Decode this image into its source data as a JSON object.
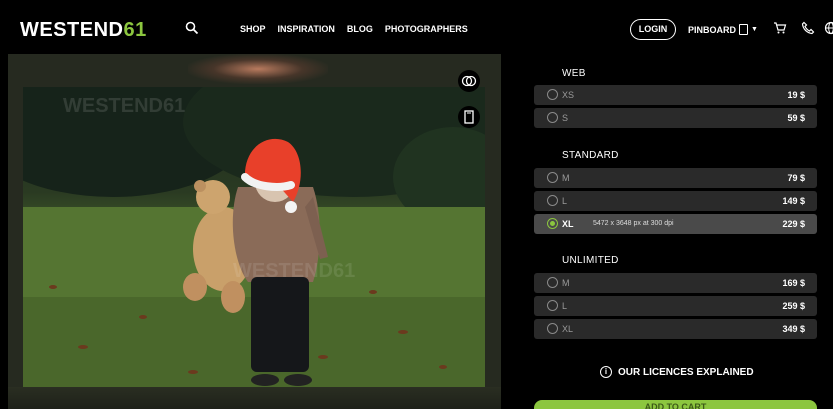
{
  "header": {
    "logo_main": "WESTEND",
    "logo_accent": "61",
    "nav": [
      "SHOP",
      "INSPIRATION",
      "BLOG",
      "PHOTOGRAPHERS"
    ],
    "login_label": "LOGIN",
    "pinboard_label": "PINBOARD",
    "icons": [
      "search-icon",
      "pinboard-icon",
      "cart-icon",
      "phone-icon",
      "globe-icon"
    ]
  },
  "viewer": {
    "photo_subject": "child in red Santa hat holding teddy bear on grass",
    "watermark": "WESTEND61",
    "tools": [
      "compare-icon",
      "pinboard-add-icon"
    ]
  },
  "licences": {
    "web": {
      "title": "WEB",
      "options": [
        {
          "size": "XS",
          "price": "19 $"
        },
        {
          "size": "S",
          "price": "59 $"
        }
      ]
    },
    "standard": {
      "title": "STANDARD",
      "options": [
        {
          "size": "M",
          "price": "79 $"
        },
        {
          "size": "L",
          "price": "149 $"
        },
        {
          "size": "XL",
          "price": "229 $",
          "spec": "5472 x 3648 px at 300 dpi",
          "selected": true
        }
      ]
    },
    "unlimited": {
      "title": "UNLIMITED",
      "options": [
        {
          "size": "M",
          "price": "169 $"
        },
        {
          "size": "L",
          "price": "259 $"
        },
        {
          "size": "XL",
          "price": "349 $"
        }
      ]
    },
    "explain_label": "OUR LICENCES EXPLAINED",
    "cart_label": "ADD TO CART"
  },
  "colors": {
    "accent": "#8cc63f",
    "background": "#000000",
    "option_bg": "#2a2a2a",
    "option_selected_bg": "#4a4a4a"
  }
}
